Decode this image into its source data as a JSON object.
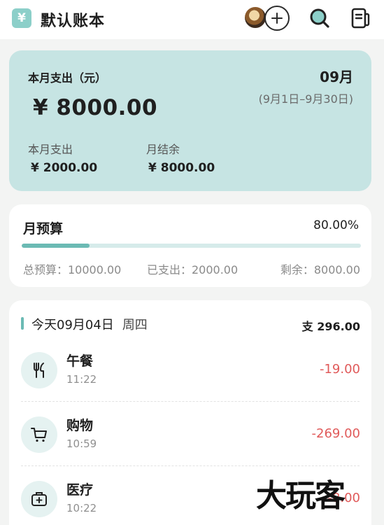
{
  "header": {
    "book_icon_symbol": "¥",
    "book_title": "默认账本",
    "icons": [
      "avatar",
      "add-member-icon",
      "search-icon",
      "ledger-menu-icon"
    ]
  },
  "summary": {
    "label": "本月支出（元）",
    "month": "09月",
    "range": "(9月1日–9月30日)",
    "amount": "¥ 8000.00",
    "sub": [
      {
        "label": "本月支出",
        "value": "¥ 2000.00"
      },
      {
        "label": "月结余",
        "value": "¥ 8000.00"
      }
    ]
  },
  "budget": {
    "title": "月预算",
    "percent": "80.00%",
    "progress": 0.2,
    "total": "总预算：10000.00",
    "spent": "已支出：2000.00",
    "remaining": "剩余：8000.00"
  },
  "daily": {
    "date": "今天09月04日",
    "weekday": "周四",
    "total": "支 296.00",
    "entries": [
      {
        "name": "午餐",
        "time": "11:22",
        "amount": "-19.00",
        "icon": "utensils-icon"
      },
      {
        "name": "购物",
        "time": "10:59",
        "amount": "-269.00",
        "icon": "shopping-cart-icon"
      },
      {
        "name": "医疗",
        "time": "10:22",
        "amount": "-8.00",
        "icon": "medical-kit-icon"
      }
    ]
  },
  "watermark": "大玩客",
  "colors": {
    "accent": "#6bbab4",
    "summary_bg": "#c6e4e3",
    "expense": "#e05a5a"
  }
}
